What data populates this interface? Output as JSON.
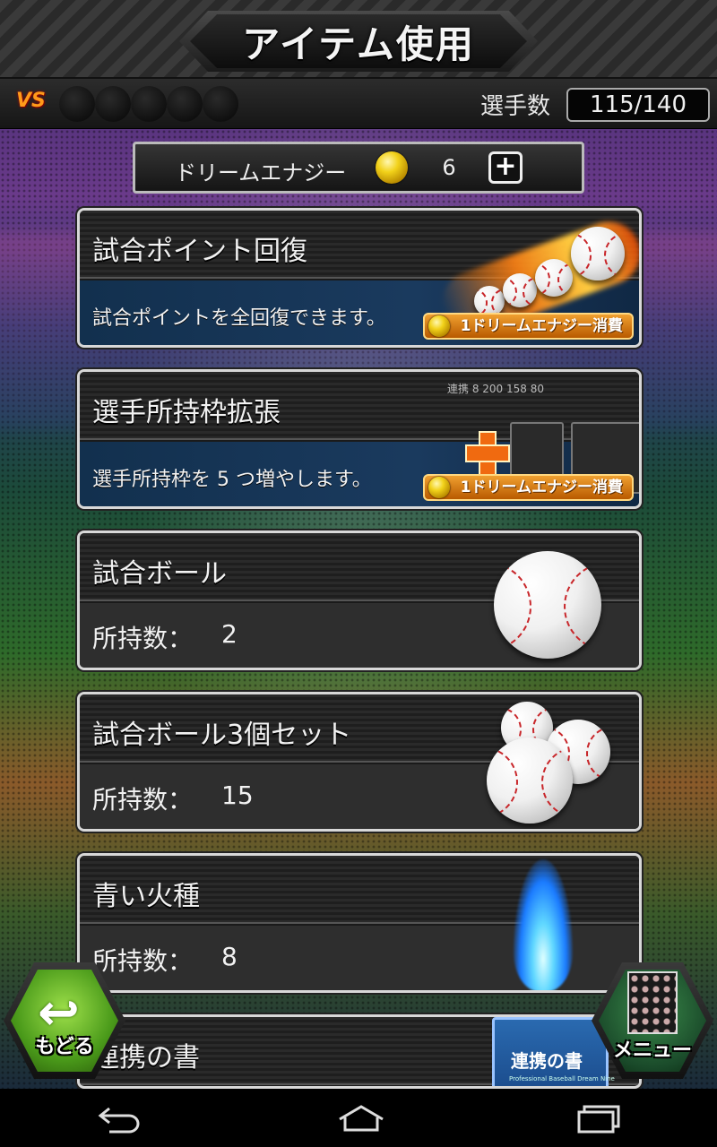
{
  "header": {
    "title": "アイテム使用"
  },
  "status": {
    "vs_label": "VS",
    "player_count_label": "選手数",
    "player_count_value": "115/140"
  },
  "energy": {
    "label": "ドリームエナジー",
    "value": "6",
    "plus_label": "+"
  },
  "items": [
    {
      "title": "試合ポイント回復",
      "description": "試合ポイントを全回復できます。",
      "cost": "1ドリームエナジー消費",
      "icon": "flaming-baseballs"
    },
    {
      "title": "選手所持枠拡張",
      "description": "選手所持枠を 5 つ増やします。",
      "cost": "1ドリームエナジー消費",
      "icon": "roster-slots-plus",
      "illustration_text": "連携 8 200 158 80"
    },
    {
      "title": "試合ボール",
      "count_label": "所持数：",
      "count": "2",
      "icon": "baseball"
    },
    {
      "title": "試合ボール3個セット",
      "count_label": "所持数：",
      "count": "15",
      "icon": "three-baseballs"
    },
    {
      "title": "青い火種",
      "count_label": "所持数：",
      "count": "8",
      "icon": "blue-flame"
    },
    {
      "title": "連携の書",
      "icon": "book",
      "book_title": "連携の書",
      "book_subtitle": "Professional Baseball Dream Nine"
    }
  ],
  "buttons": {
    "back_label": "もどる",
    "menu_label": "メニュー"
  },
  "nav": [
    "back-icon",
    "home-icon",
    "recent-apps-icon"
  ]
}
